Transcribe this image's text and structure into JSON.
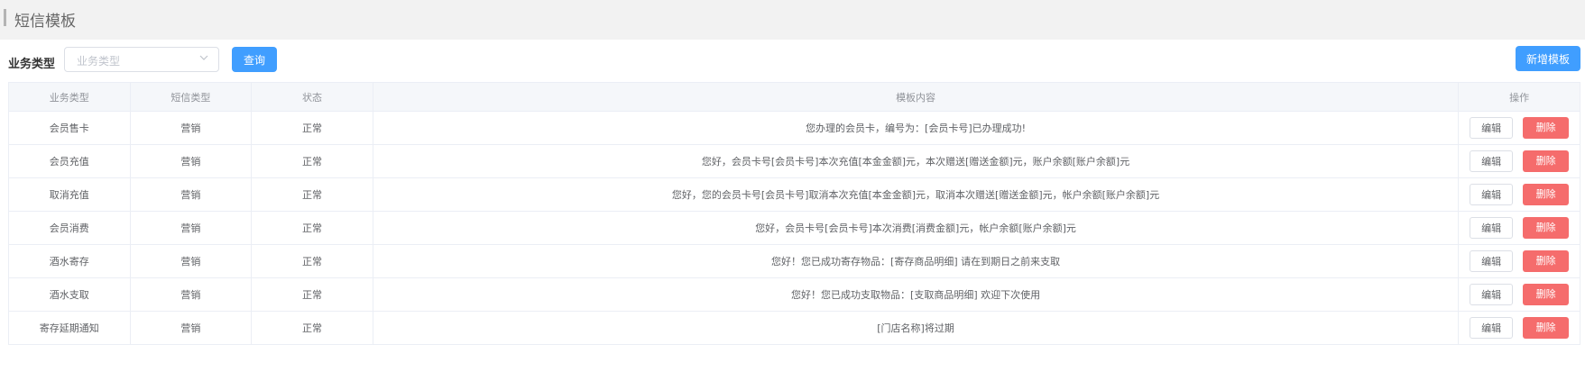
{
  "header": {
    "title": "短信模板"
  },
  "filter": {
    "label": "业务类型",
    "select_placeholder": "业务类型",
    "query_button": "查询",
    "add_button": "新增模板"
  },
  "table": {
    "columns": [
      "业务类型",
      "短信类型",
      "状态",
      "模板内容",
      "操作"
    ],
    "rows": [
      {
        "biz_type": "会员售卡",
        "sms_type": "营销",
        "status": "正常",
        "content": "您办理的会员卡，编号为：[会员卡号]已办理成功!",
        "edit": "编辑",
        "delete": "删除"
      },
      {
        "biz_type": "会员充值",
        "sms_type": "营销",
        "status": "正常",
        "content": "您好，会员卡号[会员卡号]本次充值[本金金额]元，本次赠送[赠送金额]元，账户余额[账户余额]元",
        "edit": "编辑",
        "delete": "删除"
      },
      {
        "biz_type": "取消充值",
        "sms_type": "营销",
        "status": "正常",
        "content": "您好，您的会员卡号[会员卡号]取消本次充值[本金金额]元，取消本次赠送[赠送金额]元，帐户余额[账户余额]元",
        "edit": "编辑",
        "delete": "删除"
      },
      {
        "biz_type": "会员消费",
        "sms_type": "营销",
        "status": "正常",
        "content": "您好，会员卡号[会员卡号]本次消费[消费金额]元，帐户余额[账户余额]元",
        "edit": "编辑",
        "delete": "删除"
      },
      {
        "biz_type": "酒水寄存",
        "sms_type": "营销",
        "status": "正常",
        "content": "您好！您已成功寄存物品：[寄存商品明细] 请在到期日之前来支取",
        "edit": "编辑",
        "delete": "删除"
      },
      {
        "biz_type": "酒水支取",
        "sms_type": "营销",
        "status": "正常",
        "content": "您好！您已成功支取物品：[支取商品明细] 欢迎下次使用",
        "edit": "编辑",
        "delete": "删除"
      },
      {
        "biz_type": "寄存延期通知",
        "sms_type": "营销",
        "status": "正常",
        "content": "[门店名称]将过期",
        "edit": "编辑",
        "delete": "删除"
      }
    ]
  },
  "icons": {
    "select_arrow": "chevron-down-icon"
  },
  "colors": {
    "primary": "#409eff",
    "danger": "#f56c6c"
  }
}
